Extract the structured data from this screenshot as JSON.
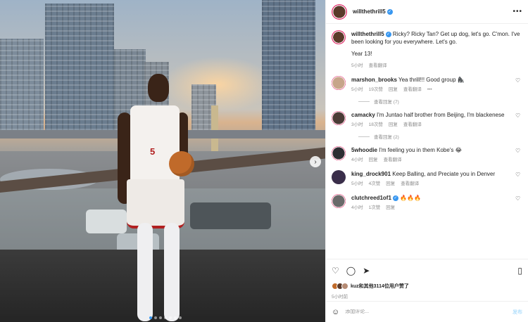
{
  "post": {
    "author": "willthethrill5",
    "caption_lines": [
      "Ricky? Ricky Tan? Get up dog, let's go. C'mon. I've been looking for you everywhere. Let's go.",
      "Year 13!"
    ],
    "caption_time": "5小时",
    "caption_translate": "查看翻译",
    "jersey_number": "5"
  },
  "comments": [
    {
      "user": "marshon_brooks",
      "text": "Yea thrill!!! Good group 🦍",
      "time": "5小时",
      "likes": "19次赞",
      "reply": "回复",
      "translate": "查看翻译",
      "more": "•••",
      "replies": "查看回复 (7)"
    },
    {
      "user": "camacky",
      "text": "I'm Juntao half brother from Beijing, I'm blackenese",
      "time": "3小时",
      "likes": "18次赞",
      "reply": "回复",
      "translate": "查看翻译",
      "replies": "查看回复 (2)"
    },
    {
      "user": "5whoodie",
      "text": "I'm feeling you in them Kobe's 😂",
      "time": "4小时",
      "reply": "回复",
      "translate": "查看翻译"
    },
    {
      "user": "king_drock901",
      "text": "Keep Balling, and Preciate you in Denver",
      "time": "5小时",
      "likes": "4次赞",
      "reply": "回复",
      "translate": "查看翻译"
    },
    {
      "user": "clutchreed1of1",
      "text": "🔥🔥🔥",
      "time": "4小时",
      "likes": "1次赞",
      "reply": "回复"
    }
  ],
  "likes_text": "kuz和其他3114位用户赞了",
  "post_date": "5小时前",
  "composer": {
    "placeholder": "添加评论...",
    "post_label": "发布"
  },
  "icons": {
    "more": "•••",
    "next": "›",
    "heart": "♡",
    "comment": "◯",
    "share": "➤",
    "save": "▯",
    "emoji": "☺"
  },
  "colors": {
    "accent": "#3897f0",
    "jersey_red": "#b11f1f"
  }
}
